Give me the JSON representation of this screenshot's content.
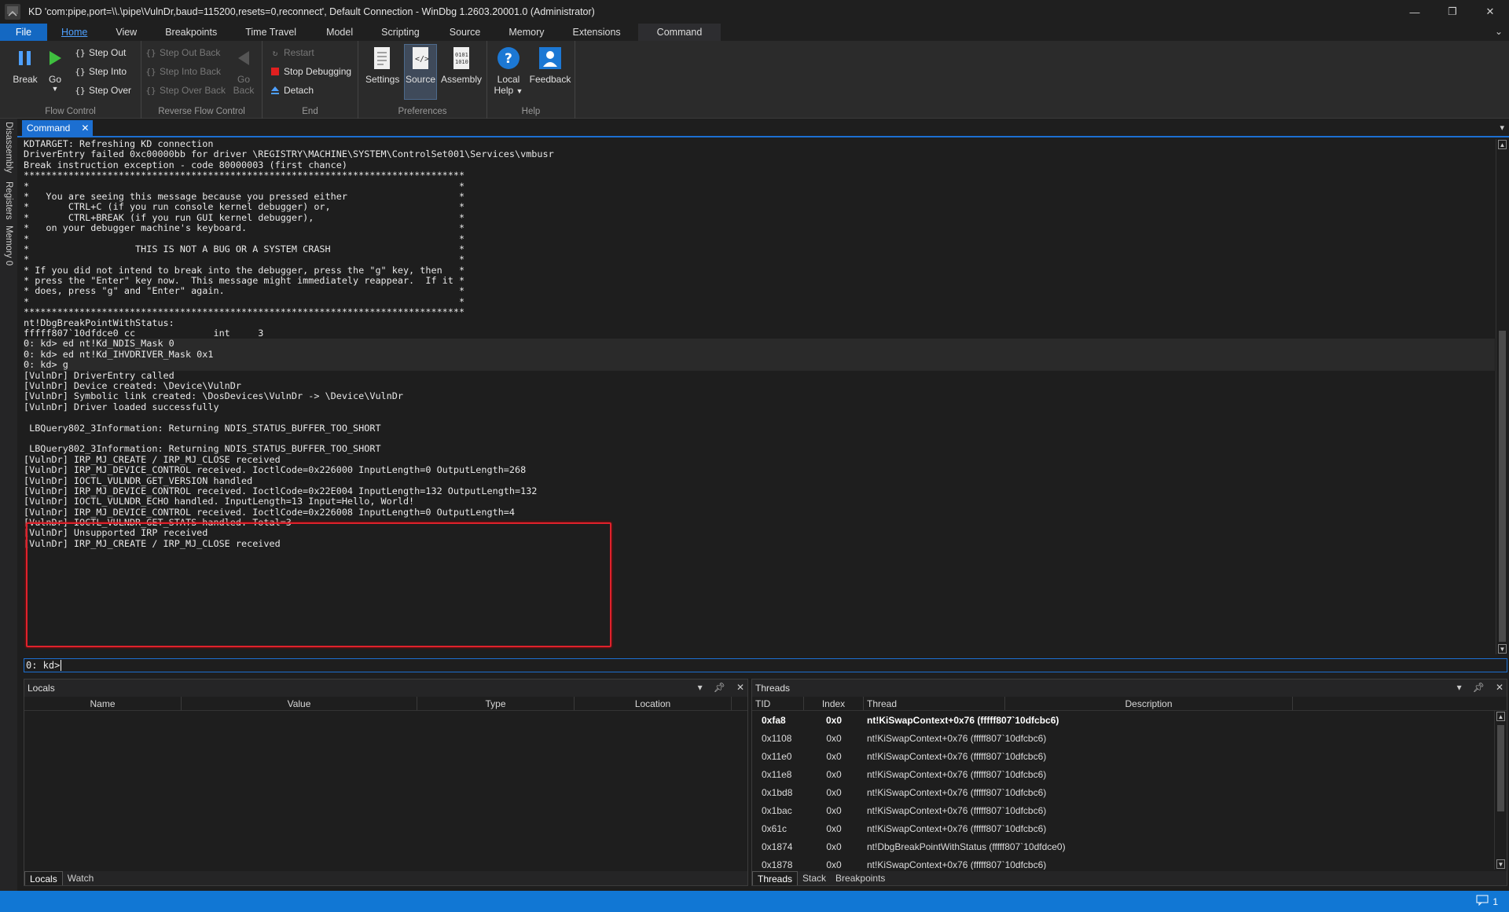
{
  "window": {
    "title": "KD 'com:pipe,port=\\\\.\\pipe\\VulnDr,baud=115200,resets=0,reconnect', Default Connection  - WinDbg 1.2603.20001.0 (Administrator)",
    "minimize": "—",
    "maximize": "❐",
    "close": "✕"
  },
  "menu": {
    "tabs": [
      "File",
      "Home",
      "View",
      "Breakpoints",
      "Time Travel",
      "Model",
      "Scripting",
      "Source",
      "Memory",
      "Extensions",
      "Command"
    ],
    "active": "Home",
    "collapse": "⌄"
  },
  "ribbon": {
    "flow_control": {
      "label": "Flow Control",
      "break": "Break",
      "go": "Go",
      "step_out": "Step Out",
      "step_into": "Step Into",
      "step_over": "Step Over"
    },
    "reverse_flow": {
      "label": "Reverse Flow Control",
      "step_out_back": "Step Out Back",
      "step_into_back": "Step Into Back",
      "step_over_back": "Step Over Back",
      "go_back_1": "Go",
      "go_back_2": "Back"
    },
    "end": {
      "label": "End",
      "restart": "Restart",
      "stop": "Stop Debugging",
      "detach": "Detach"
    },
    "preferences": {
      "label": "Preferences",
      "settings": "Settings",
      "source": "Source",
      "assembly": "Assembly"
    },
    "help": {
      "label": "Help",
      "local_help_1": "Local",
      "local_help_2": "Help",
      "feedback": "Feedback"
    }
  },
  "side_tabs": [
    "Disassembly",
    "Registers",
    "Memory 0"
  ],
  "command_window": {
    "tab_label": "Command",
    "prompt": "0: kd>",
    "lines": [
      {
        "text": "KDTARGET: Refreshing KD connection"
      },
      {
        "text": "DriverEntry failed 0xc00000bb for driver \\REGISTRY\\MACHINE\\SYSTEM\\ControlSet001\\Services\\vmbusr"
      },
      {
        "text": "Break instruction exception - code 80000003 (first chance)"
      },
      {
        "text": "*******************************************************************************"
      },
      {
        "text": "*                                                                             *"
      },
      {
        "text": "*   You are seeing this message because you pressed either                    *"
      },
      {
        "text": "*       CTRL+C (if you run console kernel debugger) or,                       *"
      },
      {
        "text": "*       CTRL+BREAK (if you run GUI kernel debugger),                          *"
      },
      {
        "text": "*   on your debugger machine's keyboard.                                      *"
      },
      {
        "text": "*                                                                             *"
      },
      {
        "text": "*                   THIS IS NOT A BUG OR A SYSTEM CRASH                       *"
      },
      {
        "text": "*                                                                             *"
      },
      {
        "text": "* If you did not intend to break into the debugger, press the \"g\" key, then   *"
      },
      {
        "text": "* press the \"Enter\" key now.  This message might immediately reappear.  If it *"
      },
      {
        "text": "* does, press \"g\" and \"Enter\" again.                                          *"
      },
      {
        "text": "*                                                                             *"
      },
      {
        "text": "*******************************************************************************"
      },
      {
        "text": "nt!DbgBreakPointWithStatus:"
      },
      {
        "text": "fffff807`10dfdce0 cc              int     3"
      },
      {
        "text": "0: kd> ed nt!Kd_NDIS_Mask 0",
        "hl": true
      },
      {
        "text": "0: kd> ed nt!Kd_IHVDRIVER_Mask 0x1",
        "hl": true
      },
      {
        "text": "0: kd> g",
        "hl": true
      },
      {
        "text": "[VulnDr] DriverEntry called"
      },
      {
        "text": "[VulnDr] Device created: \\Device\\VulnDr"
      },
      {
        "text": "[VulnDr] Symbolic link created: \\DosDevices\\VulnDr -> \\Device\\VulnDr"
      },
      {
        "text": "[VulnDr] Driver loaded successfully"
      },
      {
        "text": ""
      },
      {
        "text": " LBQuery802_3Information: Returning NDIS_STATUS_BUFFER_TOO_SHORT"
      },
      {
        "text": ""
      },
      {
        "text": " LBQuery802_3Information: Returning NDIS_STATUS_BUFFER_TOO_SHORT"
      },
      {
        "text": "[VulnDr] IRP_MJ_CREATE / IRP_MJ_CLOSE received"
      },
      {
        "text": "[VulnDr] IRP_MJ_DEVICE_CONTROL received. IoctlCode=0x226000 InputLength=0 OutputLength=268"
      },
      {
        "text": "[VulnDr] IOCTL_VULNDR_GET_VERSION handled"
      },
      {
        "text": "[VulnDr] IRP_MJ_DEVICE_CONTROL received. IoctlCode=0x22E004 InputLength=132 OutputLength=132"
      },
      {
        "text": "[VulnDr] IOCTL_VULNDR_ECHO handled. InputLength=13 Input=Hello, World!"
      },
      {
        "text": "[VulnDr] IRP_MJ_DEVICE_CONTROL received. IoctlCode=0x226008 InputLength=0 OutputLength=4"
      },
      {
        "text": "[VulnDr] IOCTL_VULNDR_GET_STATS handled. Total=3"
      },
      {
        "text": "[VulnDr] Unsupported IRP received"
      },
      {
        "text": "[VulnDr] IRP_MJ_CREATE / IRP_MJ_CLOSE received"
      }
    ]
  },
  "locals_panel": {
    "title": "Locals",
    "columns": [
      "Name",
      "Value",
      "Type",
      "Location"
    ],
    "tabs": [
      "Locals",
      "Watch"
    ],
    "active_tab": "Locals"
  },
  "threads_panel": {
    "title": "Threads",
    "columns": [
      "TID",
      "Index",
      "Thread",
      "Description"
    ],
    "rows": [
      {
        "tid": "0xfa8",
        "index": "0x0",
        "thread": "nt!KiSwapContext+0x76 (fffff807`10dfcbc6)",
        "current": true
      },
      {
        "tid": "0x1108",
        "index": "0x0",
        "thread": "nt!KiSwapContext+0x76 (fffff807`10dfcbc6)"
      },
      {
        "tid": "0x11e0",
        "index": "0x0",
        "thread": "nt!KiSwapContext+0x76 (fffff807`10dfcbc6)"
      },
      {
        "tid": "0x11e8",
        "index": "0x0",
        "thread": "nt!KiSwapContext+0x76 (fffff807`10dfcbc6)"
      },
      {
        "tid": "0x1bd8",
        "index": "0x0",
        "thread": "nt!KiSwapContext+0x76 (fffff807`10dfcbc6)"
      },
      {
        "tid": "0x1bac",
        "index": "0x0",
        "thread": "nt!KiSwapContext+0x76 (fffff807`10dfcbc6)"
      },
      {
        "tid": "0x61c",
        "index": "0x0",
        "thread": "nt!KiSwapContext+0x76 (fffff807`10dfcbc6)"
      },
      {
        "tid": "0x1874",
        "index": "0x0",
        "thread": "nt!DbgBreakPointWithStatus (fffff807`10dfdce0)"
      },
      {
        "tid": "0x1878",
        "index": "0x0",
        "thread": "nt!KiSwapContext+0x76 (fffff807`10dfcbc6)"
      }
    ],
    "tabs": [
      "Threads",
      "Stack",
      "Breakpoints"
    ],
    "active_tab": "Threads"
  },
  "statusbar": {
    "notification_count": "1"
  },
  "colors": {
    "accent": "#1c6fd1",
    "highlight_box": "#e0212c",
    "status_bar": "#1177d4"
  }
}
